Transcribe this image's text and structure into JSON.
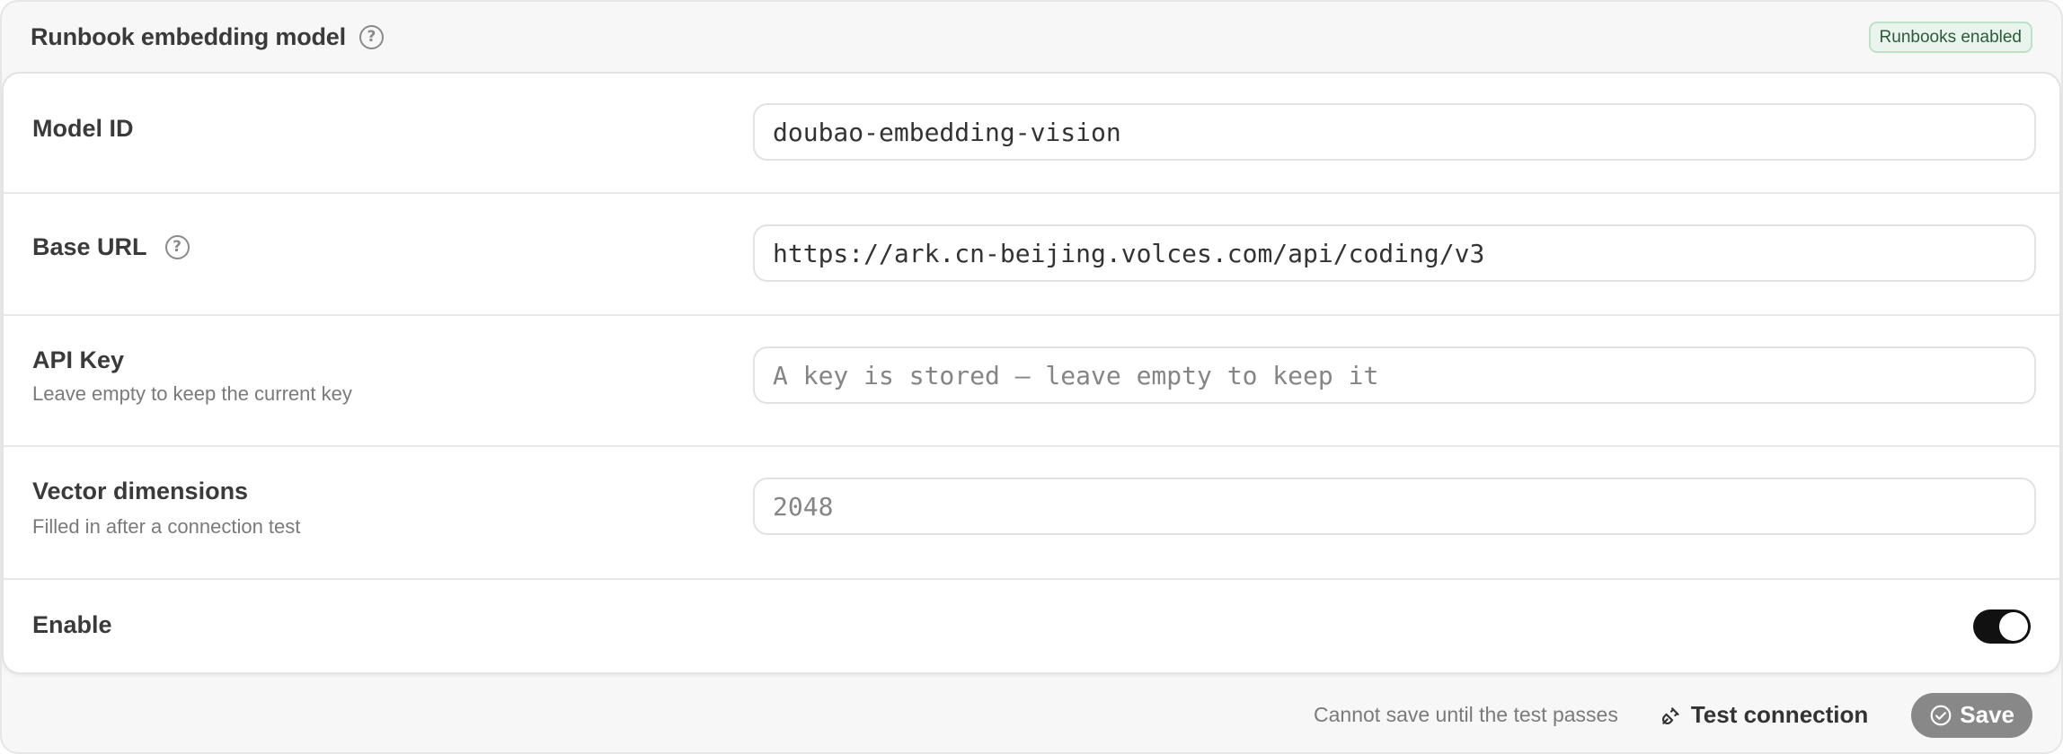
{
  "header": {
    "title": "Runbook embedding model",
    "badge": "Runbooks enabled"
  },
  "fields": {
    "model_id": {
      "label": "Model ID",
      "value": "doubao-embedding-vision"
    },
    "base_url": {
      "label": "Base URL",
      "value": "https://ark.cn-beijing.volces.com/api/coding/v3"
    },
    "api_key": {
      "label": "API Key",
      "sublabel": "Leave empty to keep the current key",
      "value": "",
      "placeholder": "A key is stored — leave empty to keep it"
    },
    "vector_dimensions": {
      "label": "Vector dimensions",
      "sublabel": "Filled in after a connection test",
      "value": "",
      "placeholder": "2048"
    },
    "enable": {
      "label": "Enable",
      "on": true
    }
  },
  "footer": {
    "note": "Cannot save until the test passes",
    "test_label": "Test connection",
    "save_label": "Save"
  },
  "icons": {
    "help": "question-circle-icon",
    "plug": "plug-icon",
    "check": "check-circle-icon"
  },
  "colors": {
    "badge_bg": "#e9f4ec",
    "badge_border": "#bfe0c8",
    "toggle_on": "#111111",
    "save_disabled": "#888888"
  }
}
